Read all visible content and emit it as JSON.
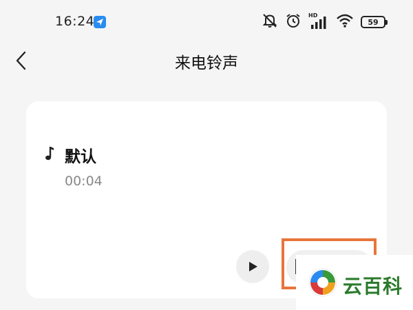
{
  "status_bar": {
    "time": "16:24",
    "hd_label": "HD",
    "battery_level": "59",
    "icons": [
      "navigation-app-icon",
      "mute-icon",
      "alarm-icon",
      "signal-icon",
      "wifi-icon",
      "battery-icon"
    ]
  },
  "header": {
    "back_icon": "chevron-left-icon",
    "title": "来电铃声"
  },
  "ringtone": {
    "icon": "music-note-icon",
    "name": "默认",
    "duration": "00:04",
    "play_icon": "play-icon"
  },
  "watermark": {
    "text": "云百科"
  },
  "colors": {
    "background": "#f5f5f5",
    "card": "#ffffff",
    "highlight": "#e8743a",
    "watermark_text": "#2b7a2b",
    "status_app_icon": "#2a8cf0"
  }
}
